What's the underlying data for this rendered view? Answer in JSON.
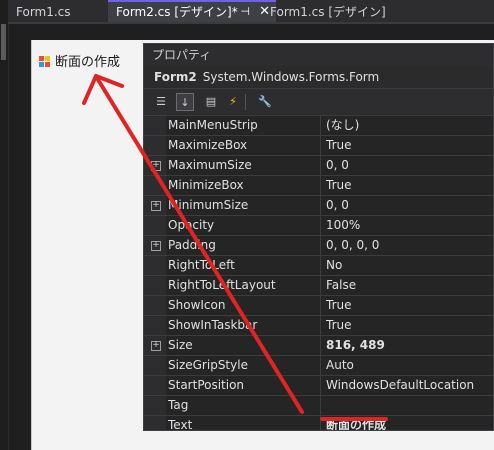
{
  "tabs": [
    {
      "label": "Form1.cs"
    },
    {
      "label": "Form2.cs [デザイン]*"
    },
    {
      "label": "Form1.cs [デザイン]"
    }
  ],
  "designer": {
    "form_title": "断面の作成"
  },
  "properties": {
    "header": "プロパティ",
    "object_name": "Form2",
    "object_type": "System.Windows.Forms.Form",
    "rows": [
      {
        "name": "MainMenuStrip",
        "value": "(なし)",
        "expandable": false
      },
      {
        "name": "MaximizeBox",
        "value": "True",
        "expandable": false
      },
      {
        "name": "MaximumSize",
        "value": "0, 0",
        "expandable": true
      },
      {
        "name": "MinimizeBox",
        "value": "True",
        "expandable": false
      },
      {
        "name": "MinimumSize",
        "value": "0, 0",
        "expandable": true
      },
      {
        "name": "Opacity",
        "value": "100%",
        "expandable": false
      },
      {
        "name": "Padding",
        "value": "0, 0, 0, 0",
        "expandable": true
      },
      {
        "name": "RightToLeft",
        "value": "No",
        "expandable": false
      },
      {
        "name": "RightToLeftLayout",
        "value": "False",
        "expandable": false
      },
      {
        "name": "ShowIcon",
        "value": "True",
        "expandable": false
      },
      {
        "name": "ShowInTaskbar",
        "value": "True",
        "expandable": false
      },
      {
        "name": "Size",
        "value": "816, 489",
        "expandable": true,
        "bold": true
      },
      {
        "name": "SizeGripStyle",
        "value": "Auto",
        "expandable": false
      },
      {
        "name": "StartPosition",
        "value": "WindowsDefaultLocation",
        "expandable": false
      },
      {
        "name": "Tag",
        "value": "",
        "expandable": false
      },
      {
        "name": "Text",
        "value": "断面の作成",
        "expandable": false,
        "bold": true
      }
    ]
  },
  "colors": {
    "annotation": "#e02424",
    "active_tab_accent": "#7160e8"
  }
}
